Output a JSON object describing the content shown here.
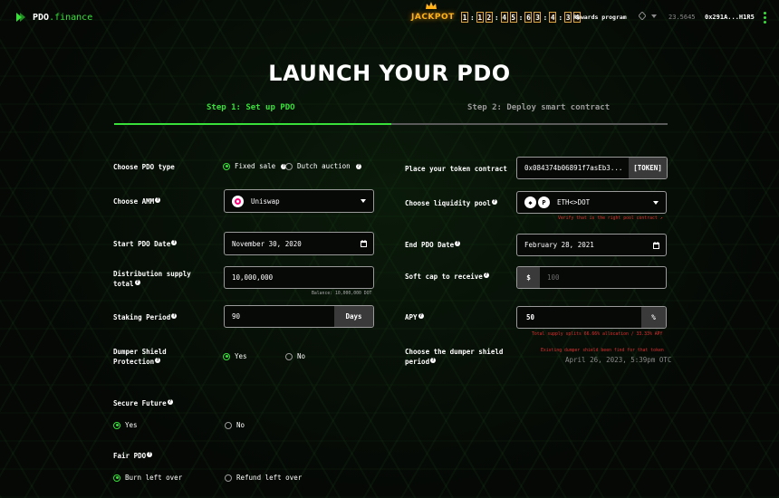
{
  "header": {
    "logo_text": "PDO",
    "logo_ext": ".finance",
    "jackpot_label": "JACKPOT",
    "timer_digits": [
      "1",
      "1",
      "2",
      "4",
      "5",
      "6",
      "3",
      "4",
      "3",
      "4"
    ],
    "rewards_label": "Rewards program",
    "balance": "23.5645",
    "address": "0x291A...H1R5"
  },
  "page": {
    "title": "LAUNCH YOUR PDO",
    "tabs": [
      {
        "label": "Step 1: Set up PDO",
        "active": true
      },
      {
        "label": "Step 2: Deploy smart contract",
        "active": false
      }
    ]
  },
  "form": {
    "pdo_type": {
      "label": "Choose PDO type",
      "options": [
        "Fixed sale",
        "Dutch auction"
      ],
      "selected": "Fixed sale"
    },
    "amm": {
      "label": "Choose AMM",
      "value": "Uniswap"
    },
    "start_date": {
      "label": "Start PDO Date",
      "value": "November 30, 2020"
    },
    "distribution": {
      "label_line1": "Distribution supply",
      "label_line2": "total",
      "value": "10,000,000",
      "hint": "Balance: 10,000,000 DOT"
    },
    "staking": {
      "label": "Staking Period",
      "value": "90",
      "unit": "Days"
    },
    "dumper_shield": {
      "label_line1": "Dumper Shield",
      "label_line2": "Protection",
      "options": [
        "Yes",
        "No"
      ],
      "selected": "Yes"
    },
    "secure_future": {
      "label": "Secure Future",
      "options": [
        "Yes",
        "No"
      ],
      "selected": "Yes"
    },
    "fair_pdo": {
      "label": "Fair PDO",
      "options": [
        "Burn left over",
        "Refund left over"
      ],
      "selected": "Burn left over"
    },
    "token_contract": {
      "label": "Place your token contract",
      "value": "0x084374b06891f7asEb3...",
      "button": "[TOKEN]"
    },
    "liquidity_pool": {
      "label": "Choose liquidity pool",
      "value": "ETH<>DOT",
      "error": "Verify that is the right pool contract"
    },
    "end_date": {
      "label": "End PDO Date",
      "value": "February 28, 2021"
    },
    "soft_cap": {
      "label": "Soft cap to receive",
      "prefix": "$",
      "placeholder": "100"
    },
    "apy": {
      "label": "APY",
      "value": "50",
      "unit": "%",
      "error": "Total supply splits 66.66% allocation / 33.33% APY"
    },
    "dumper_period": {
      "label_line1": "Choose the dumper shield",
      "label_line2": "period",
      "error": "Existing dumper shield been find for that token",
      "date": "April 26, 2023, 5:39pm OTC"
    }
  },
  "colors": {
    "accent": "#39e03a",
    "error": "#e03030",
    "jackpot": "#ffb21a"
  }
}
